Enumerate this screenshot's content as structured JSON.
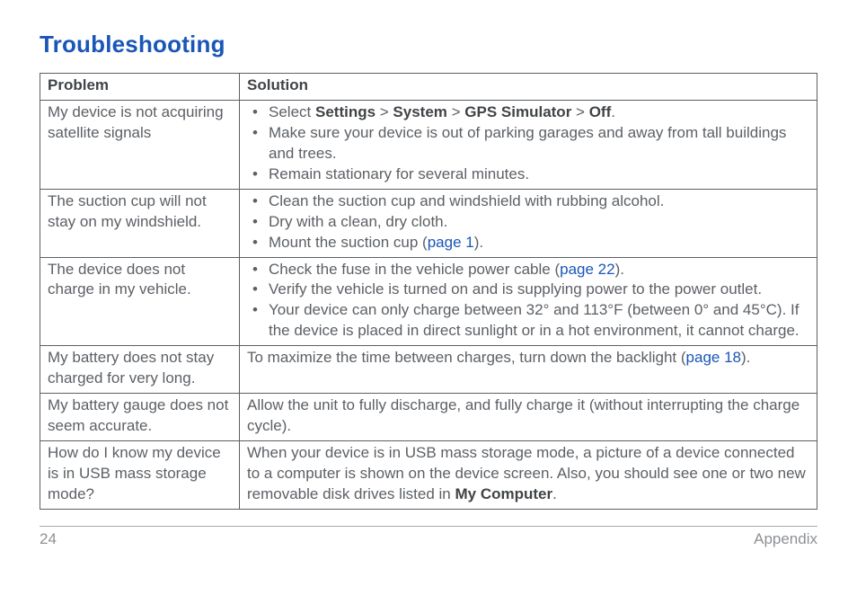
{
  "title": "Troubleshooting",
  "headers": {
    "problem": "Problem",
    "solution": "Solution"
  },
  "rows": [
    {
      "problem": "My device is not acquiring satellite signals",
      "solution_type": "list",
      "items": [
        {
          "parts": [
            {
              "t": "plain",
              "v": "Select "
            },
            {
              "t": "bold",
              "v": "Settings"
            },
            {
              "t": "plain",
              "v": " > "
            },
            {
              "t": "bold",
              "v": "System"
            },
            {
              "t": "plain",
              "v": " > "
            },
            {
              "t": "bold",
              "v": "GPS Simulator"
            },
            {
              "t": "plain",
              "v": " > "
            },
            {
              "t": "bold",
              "v": "Off"
            },
            {
              "t": "plain",
              "v": "."
            }
          ]
        },
        {
          "parts": [
            {
              "t": "plain",
              "v": "Make sure your device is out of parking garages and away from tall buildings and trees."
            }
          ]
        },
        {
          "parts": [
            {
              "t": "plain",
              "v": "Remain stationary for several minutes."
            }
          ]
        }
      ]
    },
    {
      "problem": "The suction cup will not stay on my windshield.",
      "solution_type": "list",
      "items": [
        {
          "parts": [
            {
              "t": "plain",
              "v": "Clean the suction cup and windshield with rubbing alcohol."
            }
          ]
        },
        {
          "parts": [
            {
              "t": "plain",
              "v": "Dry with a clean, dry cloth."
            }
          ]
        },
        {
          "parts": [
            {
              "t": "plain",
              "v": "Mount the suction cup ("
            },
            {
              "t": "link",
              "v": "page 1"
            },
            {
              "t": "plain",
              "v": ")."
            }
          ]
        }
      ]
    },
    {
      "problem": "The device does not charge in my vehicle.",
      "solution_type": "list",
      "items": [
        {
          "parts": [
            {
              "t": "plain",
              "v": "Check the fuse in the vehicle power cable ("
            },
            {
              "t": "link",
              "v": "page 22"
            },
            {
              "t": "plain",
              "v": ")."
            }
          ]
        },
        {
          "parts": [
            {
              "t": "plain",
              "v": "Verify the vehicle is turned on and is supplying power to the power outlet."
            }
          ]
        },
        {
          "parts": [
            {
              "t": "plain",
              "v": "Your device can only charge between 32° and 113°F (between 0° and 45°C). If the device is placed in direct sunlight or in a hot environment, it cannot charge."
            }
          ]
        }
      ]
    },
    {
      "problem": "My battery does not stay charged for very long.",
      "solution_type": "para",
      "para": [
        {
          "t": "plain",
          "v": "To maximize the time between charges, turn down the backlight ("
        },
        {
          "t": "link",
          "v": "page 18"
        },
        {
          "t": "plain",
          "v": ")."
        }
      ]
    },
    {
      "problem": "My battery gauge does not seem accurate.",
      "solution_type": "para",
      "para": [
        {
          "t": "plain",
          "v": "Allow the unit to fully discharge, and fully charge it (without interrupting the charge cycle)."
        }
      ]
    },
    {
      "problem": "How do I know my device is in USB mass storage mode?",
      "solution_type": "para",
      "para": [
        {
          "t": "plain",
          "v": "When your device is in USB mass storage mode, a picture of a device connected to a computer is shown on the device screen. Also, you should see one or two new removable disk drives listed in "
        },
        {
          "t": "bold",
          "v": "My Computer"
        },
        {
          "t": "plain",
          "v": "."
        }
      ]
    }
  ],
  "footer": {
    "page_number": "24",
    "section": "Appendix"
  }
}
